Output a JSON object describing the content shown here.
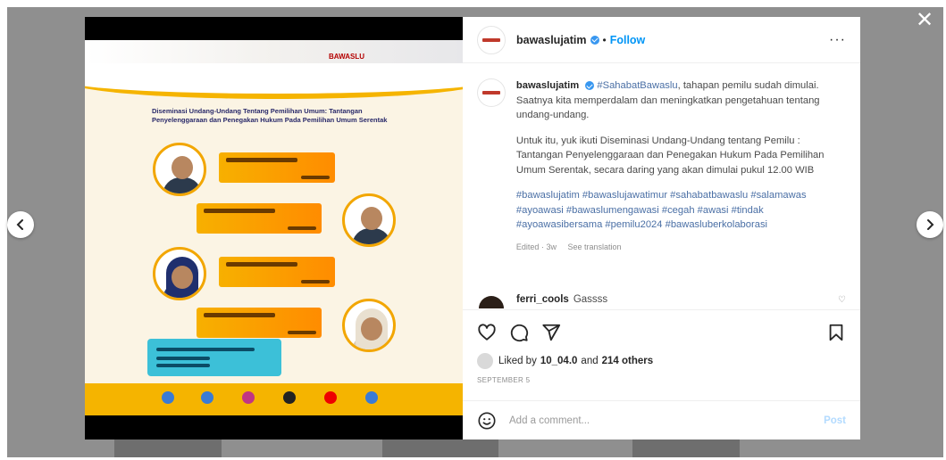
{
  "post": {
    "username": "bawaslujatim",
    "follow_label": "Follow",
    "dot": "•",
    "more_label": "···",
    "caption": {
      "username": "bawaslujatim",
      "p1_tag": "#SahabatBawaslu",
      "p1_text": ", tahapan pemilu sudah dimulai. Saatnya kita memperdalam dan meningkatkan pengetahuan tentang undang-undang.",
      "p2": "Untuk itu, yuk ikuti Diseminasi Undang-Undang tentang Pemilu : Tantangan Penyelenggaraan dan Penegakan Hukum Pada Pemilihan Umum Serentak, secara daring yang akan dimulai pukul 12.00 WIB",
      "p3_tags": "#bawaslujatim #bawaslujawatimur #sahabatbawaslu #salamawas #ayoawasi #bawaslumengawasi #cegah #awasi #tindak #ayoawasibersama #pemilu2024 #bawasluberkolaborasi",
      "edited": "Edited · 3w",
      "see_translation": "See translation"
    },
    "comment": {
      "username": "ferri_cools",
      "text": "Gassss"
    },
    "likes": {
      "prefix": "Liked by",
      "user": "10_04.0",
      "and": "and",
      "others": "214 others"
    },
    "date": "SEPTEMBER 5",
    "add_comment_placeholder": "Add a comment...",
    "post_label": "Post"
  },
  "poster": {
    "logo": "BAWASLU",
    "title": "Diseminasi Undang-Undang Tentang Pemilihan Umum: Tantangan Penyelenggaraan dan Penegakan Hukum Pada Pemilihan Umum Serentak"
  },
  "icons": {
    "close": "close-icon",
    "prev": "chevron-left-icon",
    "next": "chevron-right-icon",
    "like": "heart-icon",
    "comment": "comment-icon",
    "share": "paper-plane-icon",
    "save": "bookmark-icon",
    "emoji": "emoji-icon"
  },
  "colors": {
    "accent": "#0095f6",
    "poster_orange": "#f5b400",
    "hashtag": "#4a6fa5"
  }
}
